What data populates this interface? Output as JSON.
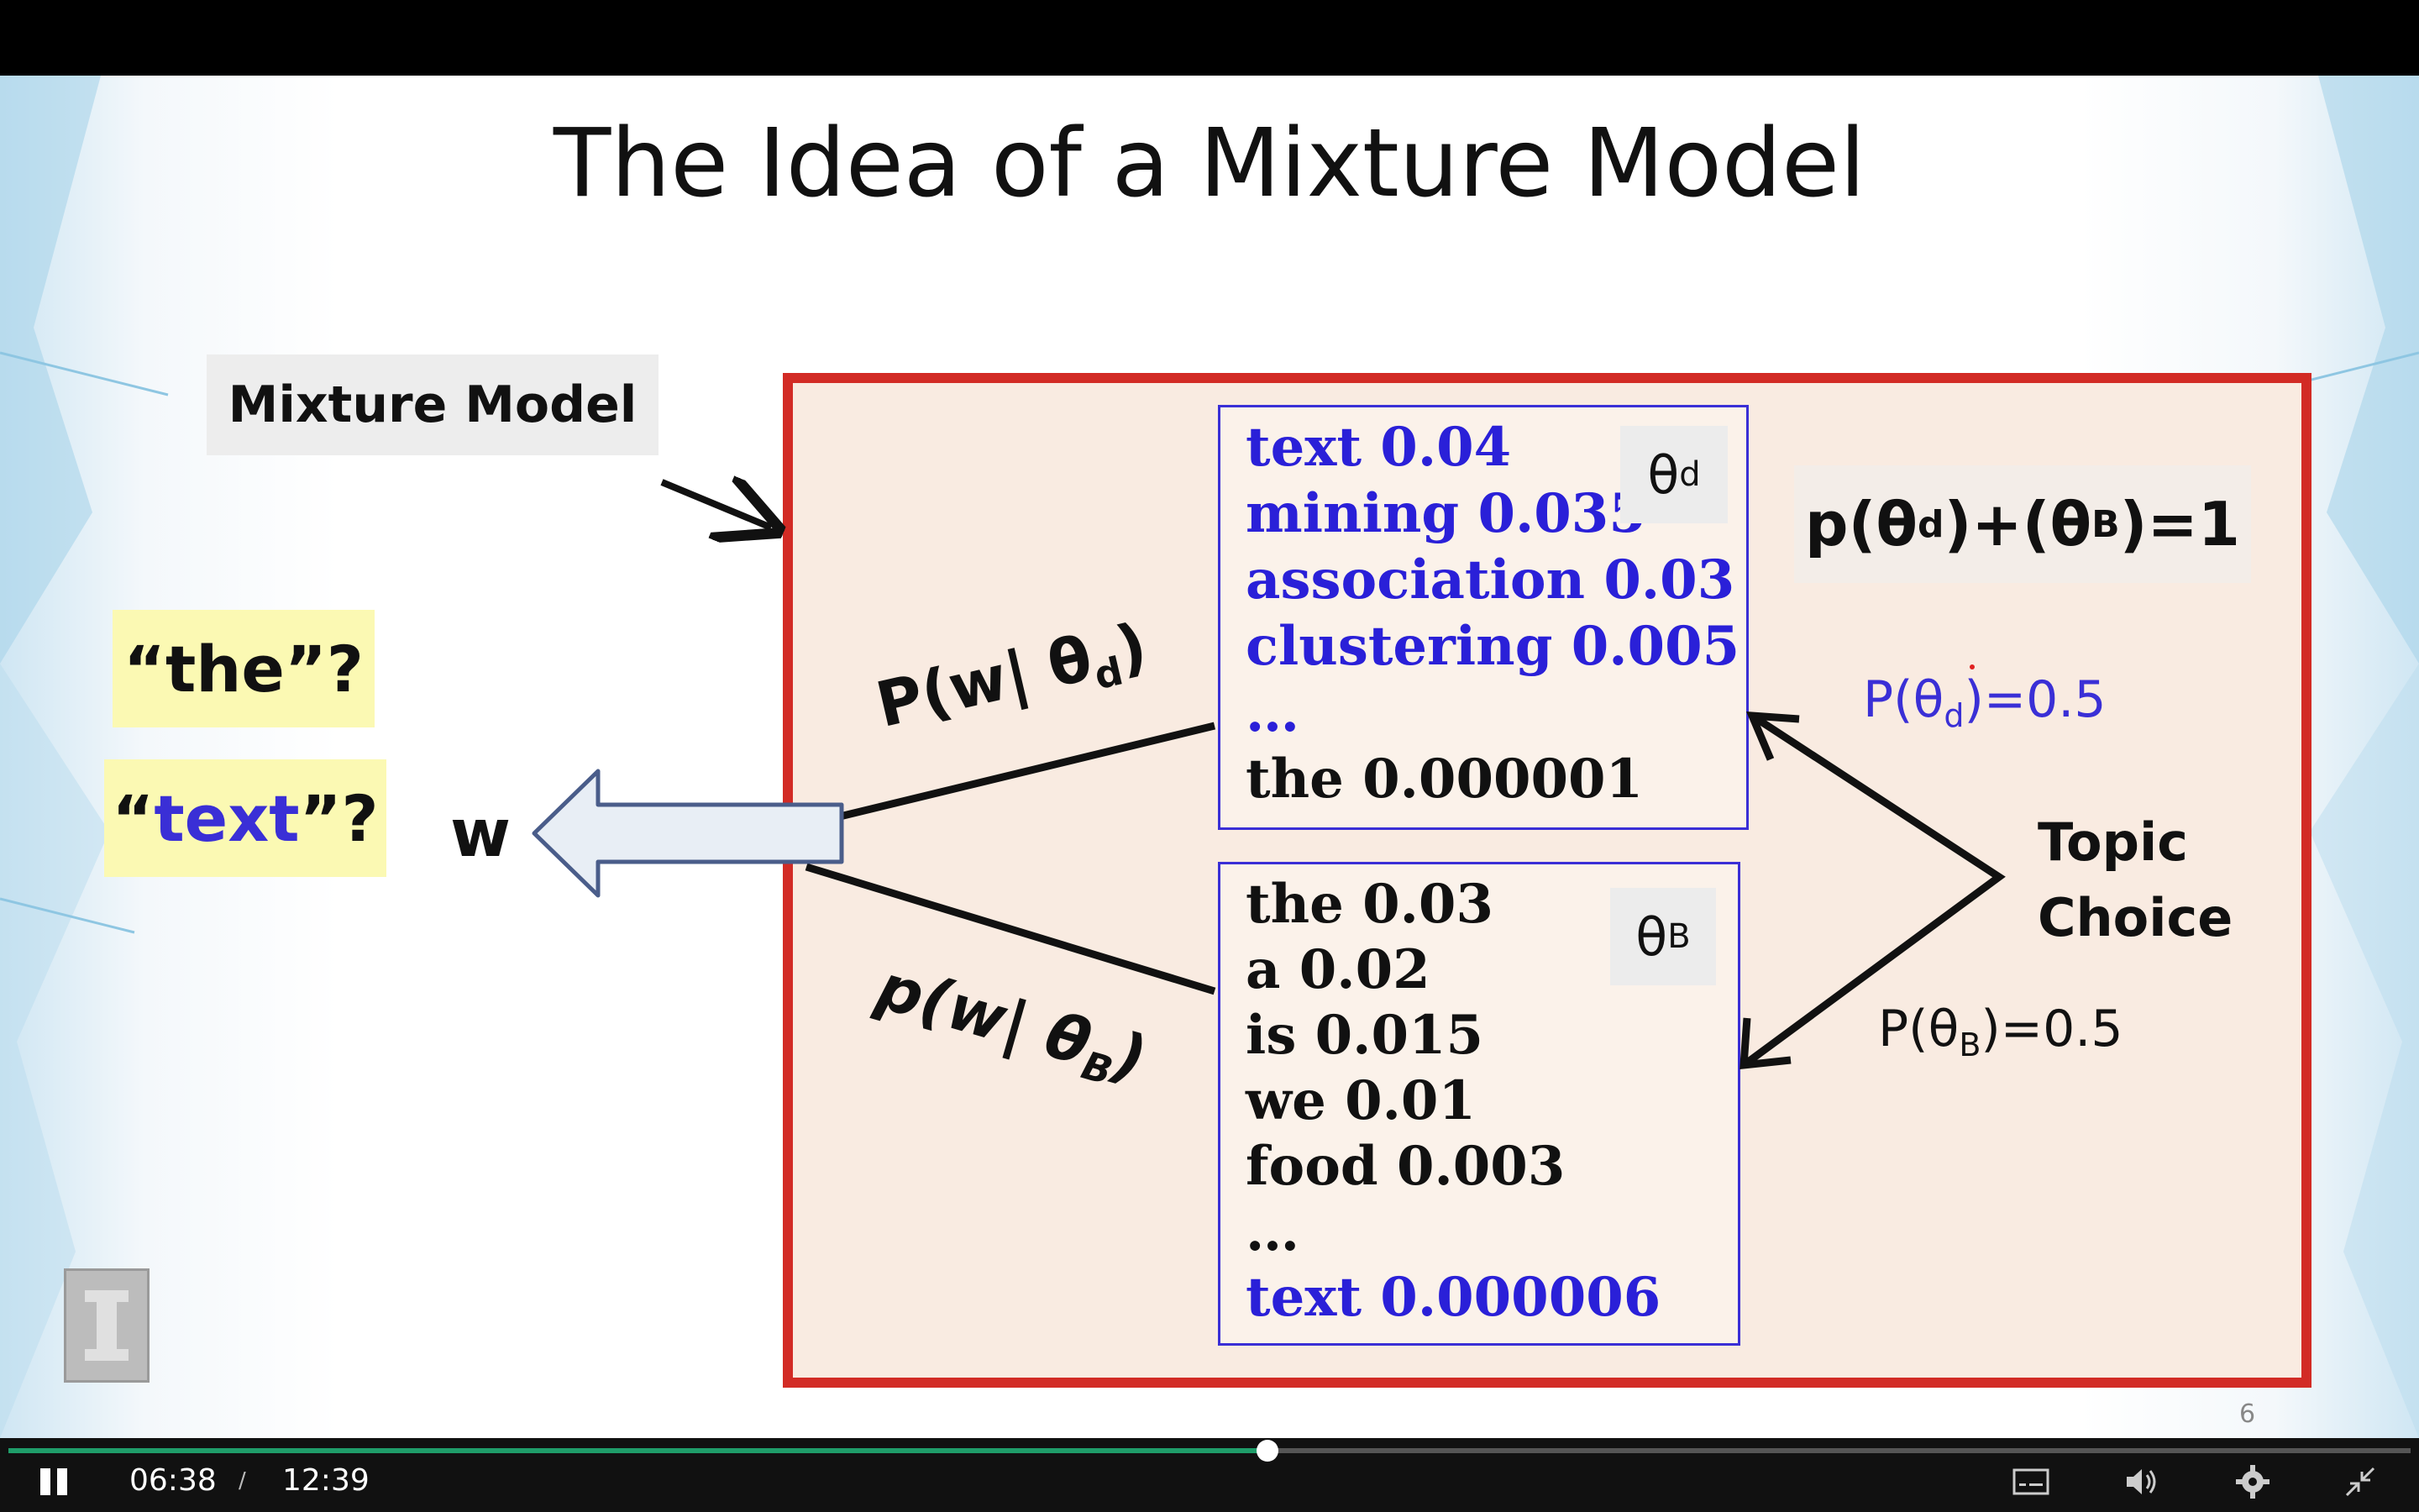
{
  "slide": {
    "title": "The Idea of a Mixture Model",
    "mixture_label": "Mixture Model",
    "queries": {
      "the_open": "“",
      "the_word": "the",
      "the_close": "”?",
      "text_open": "“",
      "text_word": "text",
      "text_close": "”?"
    },
    "w_label": "w",
    "theta_d": {
      "symbol": "θ",
      "sub": "d",
      "entries": [
        {
          "text": "text  0.04",
          "color": "blue"
        },
        {
          "text": "mining  0.035",
          "color": "blue"
        },
        {
          "text": "association 0.03",
          "color": "blue"
        },
        {
          "text": "clustering  0.005",
          "color": "blue"
        },
        {
          "text": "…",
          "color": "blue"
        },
        {
          "text": "the 0.000001",
          "color": "black"
        }
      ]
    },
    "theta_b": {
      "symbol": "θ",
      "sub": "B",
      "entries": [
        {
          "text": "the 0.03",
          "color": "black"
        },
        {
          "text": "a 0.02",
          "color": "black"
        },
        {
          "text": "is 0.015",
          "color": "black"
        },
        {
          "text": "we 0.01",
          "color": "black"
        },
        {
          "text": "food 0.003",
          "color": "black"
        },
        {
          "text": "…",
          "color": "black"
        },
        {
          "text": "text  0.000006",
          "color": "blue"
        }
      ]
    },
    "sum_constraint": {
      "part1": "p(θ",
      "sub1": "d",
      "part2": ")+(θ",
      "sub2": "B",
      "part3": ")=1"
    },
    "prob_d": {
      "part1": "P(θ",
      "sub": "d",
      "part2": ")=0.5"
    },
    "prob_b": {
      "part1": "P(θ",
      "sub": "B",
      "part2": ")=0.5"
    },
    "topic_choice": {
      "line1": "Topic",
      "line2": "Choice"
    },
    "p_w_d": {
      "part1": "P(w| θ",
      "sub": "d",
      "part2": ")"
    },
    "p_w_b": {
      "part1": "p(w| θ",
      "sub": "B",
      "part2": ")"
    },
    "page_number": "6"
  },
  "player": {
    "current_time": "06:38",
    "separator": "/",
    "duration": "12:39",
    "progress_fraction": 0.524,
    "icons": [
      "pause-icon",
      "captions-icon",
      "volume-icon",
      "settings-icon",
      "exit-fullscreen-icon"
    ],
    "colors": {
      "progress": "#1f9d6a",
      "bar": "#111111"
    }
  },
  "colors": {
    "frame": "#d22b25",
    "panel": "#f9ebe1",
    "blue_text": "#2a20d8",
    "query_bg": "#fbf9b3"
  }
}
